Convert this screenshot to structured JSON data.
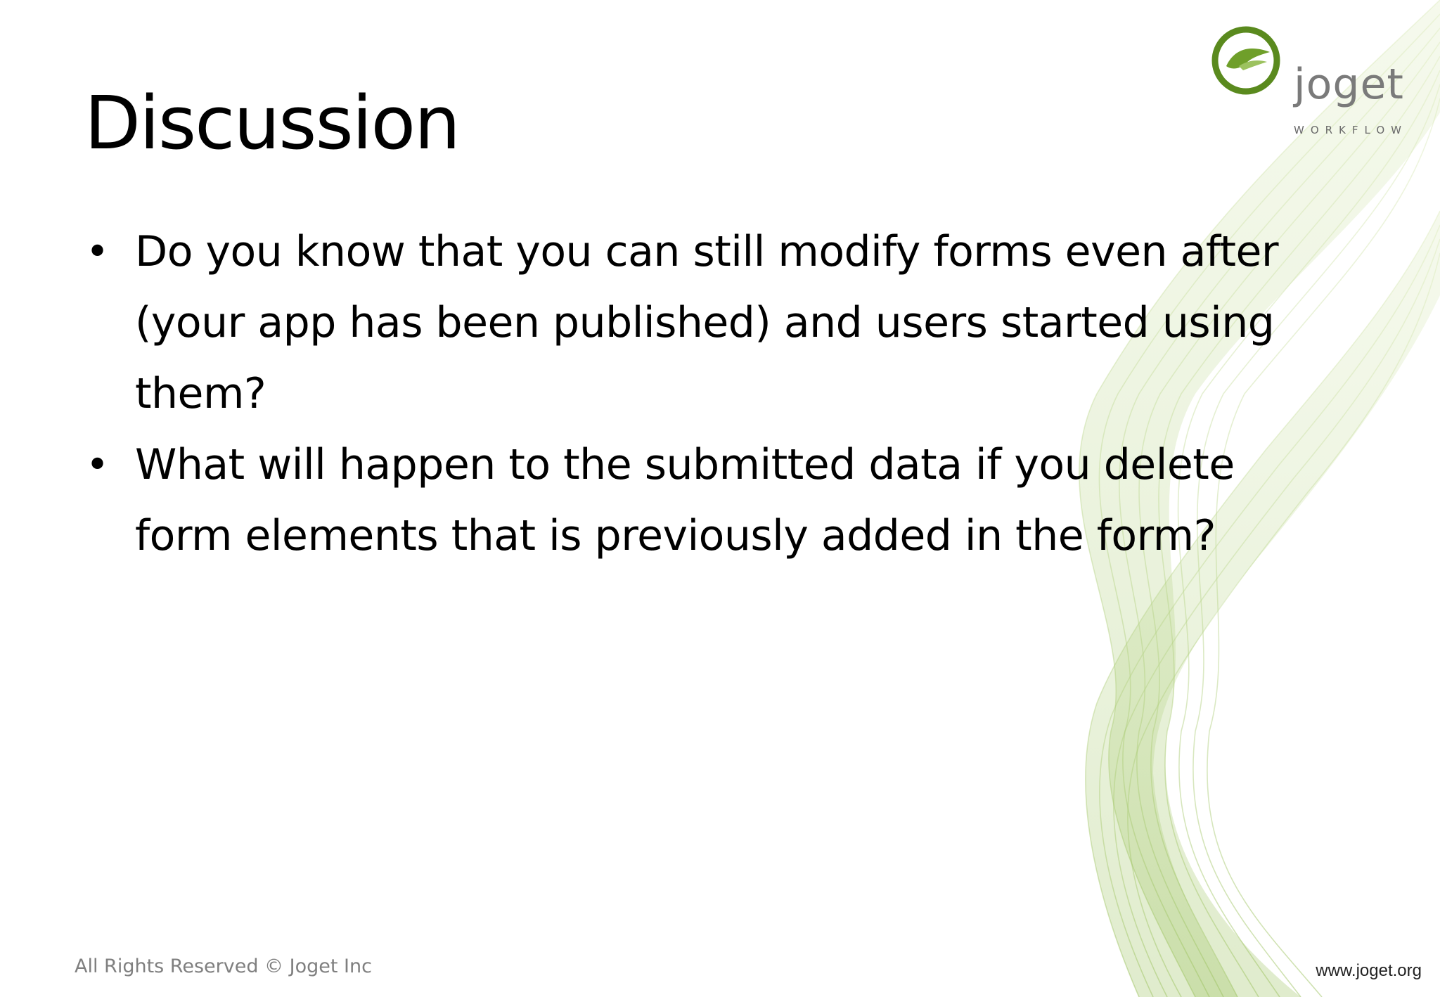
{
  "slide": {
    "title": "Discussion",
    "bullets": [
      "Do you know that you can still modify forms even after (your app has been published) and users started using them?",
      "What will happen to the submitted data if you delete form elements that is previously added in the form?"
    ],
    "bullet_symbol": "•",
    "footer_text": "All Rights Reserved © Joget Inc",
    "url_text": "www.joget.org"
  },
  "logo": {
    "wordmark": "joget",
    "tagline": "WORKFLOW"
  },
  "colors": {
    "background": "#ffffff",
    "text": "#000000",
    "footer": "#7f7f7f",
    "logo_green": "#5a8a1e",
    "swoosh_green": "#a8c96b"
  },
  "icons": {
    "logo_mark": "joget-leaf-logo-icon",
    "decoration": "green-wave-decoration"
  }
}
